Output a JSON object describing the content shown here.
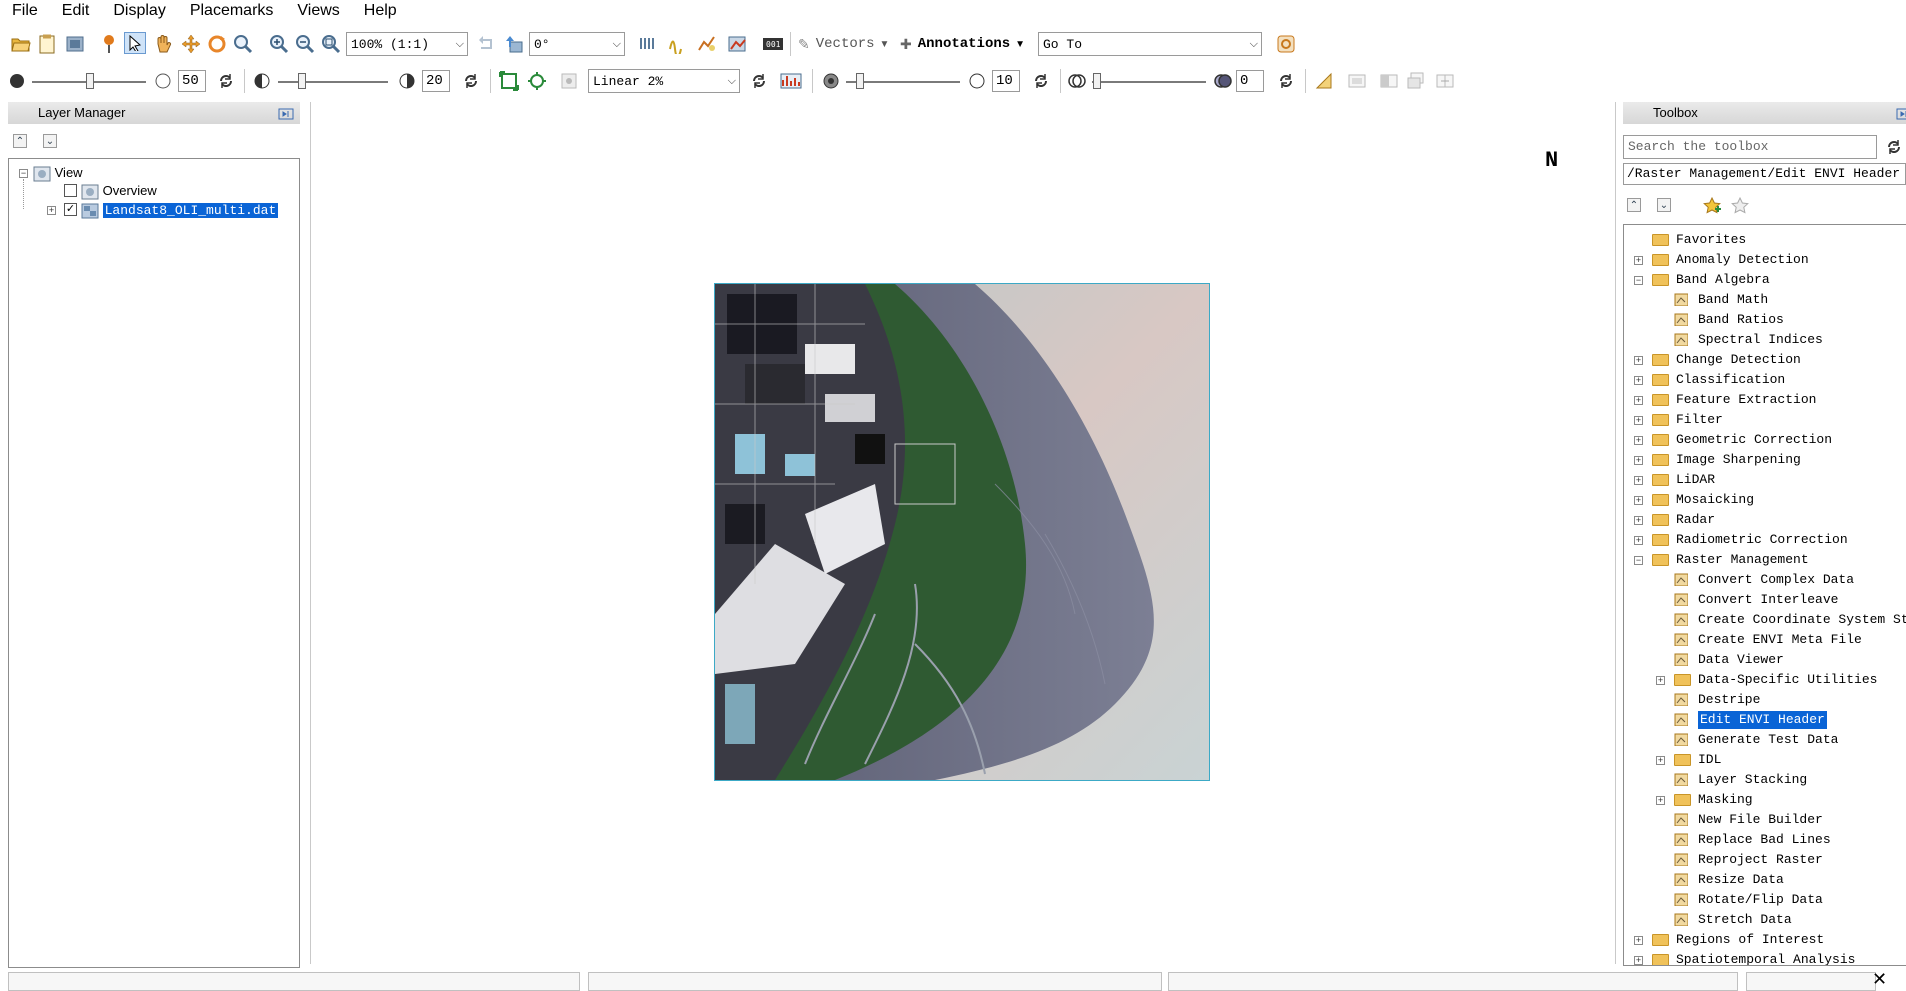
{
  "menu": [
    "File",
    "Edit",
    "Display",
    "Placemarks",
    "Views",
    "Help"
  ],
  "toolbar1": {
    "zoom_value": "100% (1:1)",
    "rotation_value": "0°",
    "vectors_label": "Vectors",
    "annotations_label": "Annotations",
    "goto_value": "Go To"
  },
  "toolbar2": {
    "brightness_value": "50",
    "contrast_value": "20",
    "stretch_value": "Linear 2%",
    "sharpen_value": "10",
    "transparency_value": "0"
  },
  "layer_manager": {
    "title": "Layer Manager",
    "tree": {
      "view_label": "View",
      "overview_label": "Overview",
      "overview_checked": false,
      "layer_label": "Landsat8_OLI_multi.dat",
      "layer_checked": true
    }
  },
  "north_arrow": "N",
  "toolbox": {
    "title": "Toolbox",
    "search_placeholder": "Search the toolbox",
    "path": "/Raster Management/Edit ENVI Header",
    "items": [
      {
        "label": "Favorites",
        "kind": "folder",
        "level": 0,
        "expander": ""
      },
      {
        "label": "Anomaly Detection",
        "kind": "folder",
        "level": 0,
        "expander": "+"
      },
      {
        "label": "Band Algebra",
        "kind": "folder",
        "level": 0,
        "expander": "-"
      },
      {
        "label": "Band Math",
        "kind": "tool",
        "level": 1,
        "expander": ""
      },
      {
        "label": "Band Ratios",
        "kind": "tool",
        "level": 1,
        "expander": ""
      },
      {
        "label": "Spectral Indices",
        "kind": "tool",
        "level": 1,
        "expander": ""
      },
      {
        "label": "Change Detection",
        "kind": "folder",
        "level": 0,
        "expander": "+"
      },
      {
        "label": "Classification",
        "kind": "folder",
        "level": 0,
        "expander": "+"
      },
      {
        "label": "Feature Extraction",
        "kind": "folder",
        "level": 0,
        "expander": "+"
      },
      {
        "label": "Filter",
        "kind": "folder",
        "level": 0,
        "expander": "+"
      },
      {
        "label": "Geometric Correction",
        "kind": "folder",
        "level": 0,
        "expander": "+"
      },
      {
        "label": "Image Sharpening",
        "kind": "folder",
        "level": 0,
        "expander": "+"
      },
      {
        "label": "LiDAR",
        "kind": "folder",
        "level": 0,
        "expander": "+"
      },
      {
        "label": "Mosaicking",
        "kind": "folder",
        "level": 0,
        "expander": "+"
      },
      {
        "label": "Radar",
        "kind": "folder",
        "level": 0,
        "expander": "+"
      },
      {
        "label": "Radiometric Correction",
        "kind": "folder",
        "level": 0,
        "expander": "+"
      },
      {
        "label": "Raster Management",
        "kind": "folder",
        "level": 0,
        "expander": "-"
      },
      {
        "label": "Convert Complex Data",
        "kind": "tool",
        "level": 1,
        "expander": ""
      },
      {
        "label": "Convert Interleave",
        "kind": "tool",
        "level": 1,
        "expander": ""
      },
      {
        "label": "Create Coordinate System String",
        "kind": "tool",
        "level": 1,
        "expander": ""
      },
      {
        "label": "Create ENVI Meta File",
        "kind": "tool",
        "level": 1,
        "expander": ""
      },
      {
        "label": "Data Viewer",
        "kind": "tool",
        "level": 1,
        "expander": ""
      },
      {
        "label": "Data-Specific Utilities",
        "kind": "folder",
        "level": 1,
        "expander": "+"
      },
      {
        "label": "Destripe",
        "kind": "tool",
        "level": 1,
        "expander": ""
      },
      {
        "label": "Edit ENVI Header",
        "kind": "tool",
        "level": 1,
        "expander": "",
        "selected": true
      },
      {
        "label": "Generate Test Data",
        "kind": "tool",
        "level": 1,
        "expander": ""
      },
      {
        "label": "IDL",
        "kind": "folder",
        "level": 1,
        "expander": "+"
      },
      {
        "label": "Layer Stacking",
        "kind": "tool",
        "level": 1,
        "expander": ""
      },
      {
        "label": "Masking",
        "kind": "folder",
        "level": 1,
        "expander": "+"
      },
      {
        "label": "New File Builder",
        "kind": "tool",
        "level": 1,
        "expander": ""
      },
      {
        "label": "Replace Bad Lines",
        "kind": "tool",
        "level": 1,
        "expander": ""
      },
      {
        "label": "Reproject Raster",
        "kind": "tool",
        "level": 1,
        "expander": ""
      },
      {
        "label": "Resize Data",
        "kind": "tool",
        "level": 1,
        "expander": ""
      },
      {
        "label": "Rotate/Flip Data",
        "kind": "tool",
        "level": 1,
        "expander": ""
      },
      {
        "label": "Stretch Data",
        "kind": "tool",
        "level": 1,
        "expander": ""
      },
      {
        "label": "Regions of Interest",
        "kind": "folder",
        "level": 0,
        "expander": "+"
      },
      {
        "label": "Spatiotemporal Analysis",
        "kind": "folder",
        "level": 0,
        "expander": "+"
      }
    ]
  },
  "colors": {
    "selection": "#0a64d6",
    "image_border": "#3ca9c6",
    "folder": "#f0c25a"
  }
}
